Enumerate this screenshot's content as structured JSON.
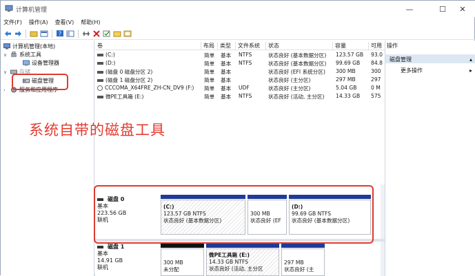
{
  "window": {
    "title": "计算机管理",
    "controls": {
      "minimize": "—",
      "maximize": "☐",
      "close": "✕"
    }
  },
  "menu": [
    "文件(F)",
    "操作(A)",
    "查看(V)",
    "帮助(H)"
  ],
  "toolbar_icons": [
    "back-icon",
    "forward-icon",
    "up-folder-icon",
    "properties-icon",
    "help-icon",
    "console-tree-icon",
    "connect-icon",
    "delete-icon",
    "check-icon",
    "folder-icon",
    "mmc-icon"
  ],
  "tree": {
    "root": "计算机管理(本地)",
    "system_tools": "系统工具",
    "device_manager": "设备管理器",
    "storage": "存储",
    "disk_management": "磁盘管理",
    "services": "服务和应用程序"
  },
  "columns": [
    "卷",
    "布局",
    "类型",
    "文件系统",
    "状态",
    "容量",
    "可用"
  ],
  "volumes": [
    {
      "name": "(C:)",
      "layout": "简单",
      "type": "基本",
      "fs": "NTFS",
      "status": "状态良好 (基本数据分区)",
      "capacity": "123.57 GB",
      "free": "93.0"
    },
    {
      "name": "(D:)",
      "layout": "简单",
      "type": "基本",
      "fs": "NTFS",
      "status": "状态良好 (基本数据分区)",
      "capacity": "99.69 GB",
      "free": "84.8"
    },
    {
      "name": "(磁盘 0 磁盘分区 2)",
      "layout": "简单",
      "type": "基本",
      "fs": "",
      "status": "状态良好 (EFI 系统分区)",
      "capacity": "300 MB",
      "free": "300"
    },
    {
      "name": "(磁盘 1 磁盘分区 2)",
      "layout": "简单",
      "type": "基本",
      "fs": "",
      "status": "状态良好 (主分区)",
      "capacity": "297 MB",
      "free": "297"
    },
    {
      "name": "CCCOMA_X64FRE_ZH-CN_DV9 (F:)",
      "layout": "简单",
      "type": "基本",
      "fs": "UDF",
      "status": "状态良好 (主分区)",
      "capacity": "5.04 GB",
      "free": "0 M"
    },
    {
      "name": "微PE工具箱 (E:)",
      "layout": "简单",
      "type": "基本",
      "fs": "NTFS",
      "status": "状态良好 (活动, 主分区)",
      "capacity": "14.33 GB",
      "free": "575"
    }
  ],
  "actions": {
    "header": "操作",
    "selected": "磁盘管理",
    "more": "更多操作"
  },
  "annotation": "系统自带的磁盘工具",
  "disk0": {
    "name": "磁盘 0",
    "type": "基本",
    "size": "223.56 GB",
    "status": "联机",
    "parts": [
      {
        "title": "(C:)",
        "line1": "123.57 GB NTFS",
        "line2": "状态良好 (基本数据分区)"
      },
      {
        "title": "",
        "line1": "300 MB",
        "line2": "状态良好 (EF"
      },
      {
        "title": "(D:)",
        "line1": "99.69 GB NTFS",
        "line2": "状态良好 (基本数据分区)"
      }
    ]
  },
  "disk1": {
    "name": "磁盘 1",
    "type": "基本",
    "size": "14.91 GB",
    "status": "联机",
    "parts": [
      {
        "title": "",
        "line1": "300 MB",
        "line2": "未分配"
      },
      {
        "title": "微PE工具箱 (E:)",
        "line1": "14.33 GB NTFS",
        "line2": "状态良好 (活动, 主分区"
      },
      {
        "title": "",
        "line1": "297 MB",
        "line2": "状态良好 (主"
      }
    ]
  },
  "colors": {
    "annotation": "#e43a2f",
    "primary_bar": "#1f3b99",
    "unallocated_bar": "#111111",
    "selection": "#dde7f4"
  }
}
